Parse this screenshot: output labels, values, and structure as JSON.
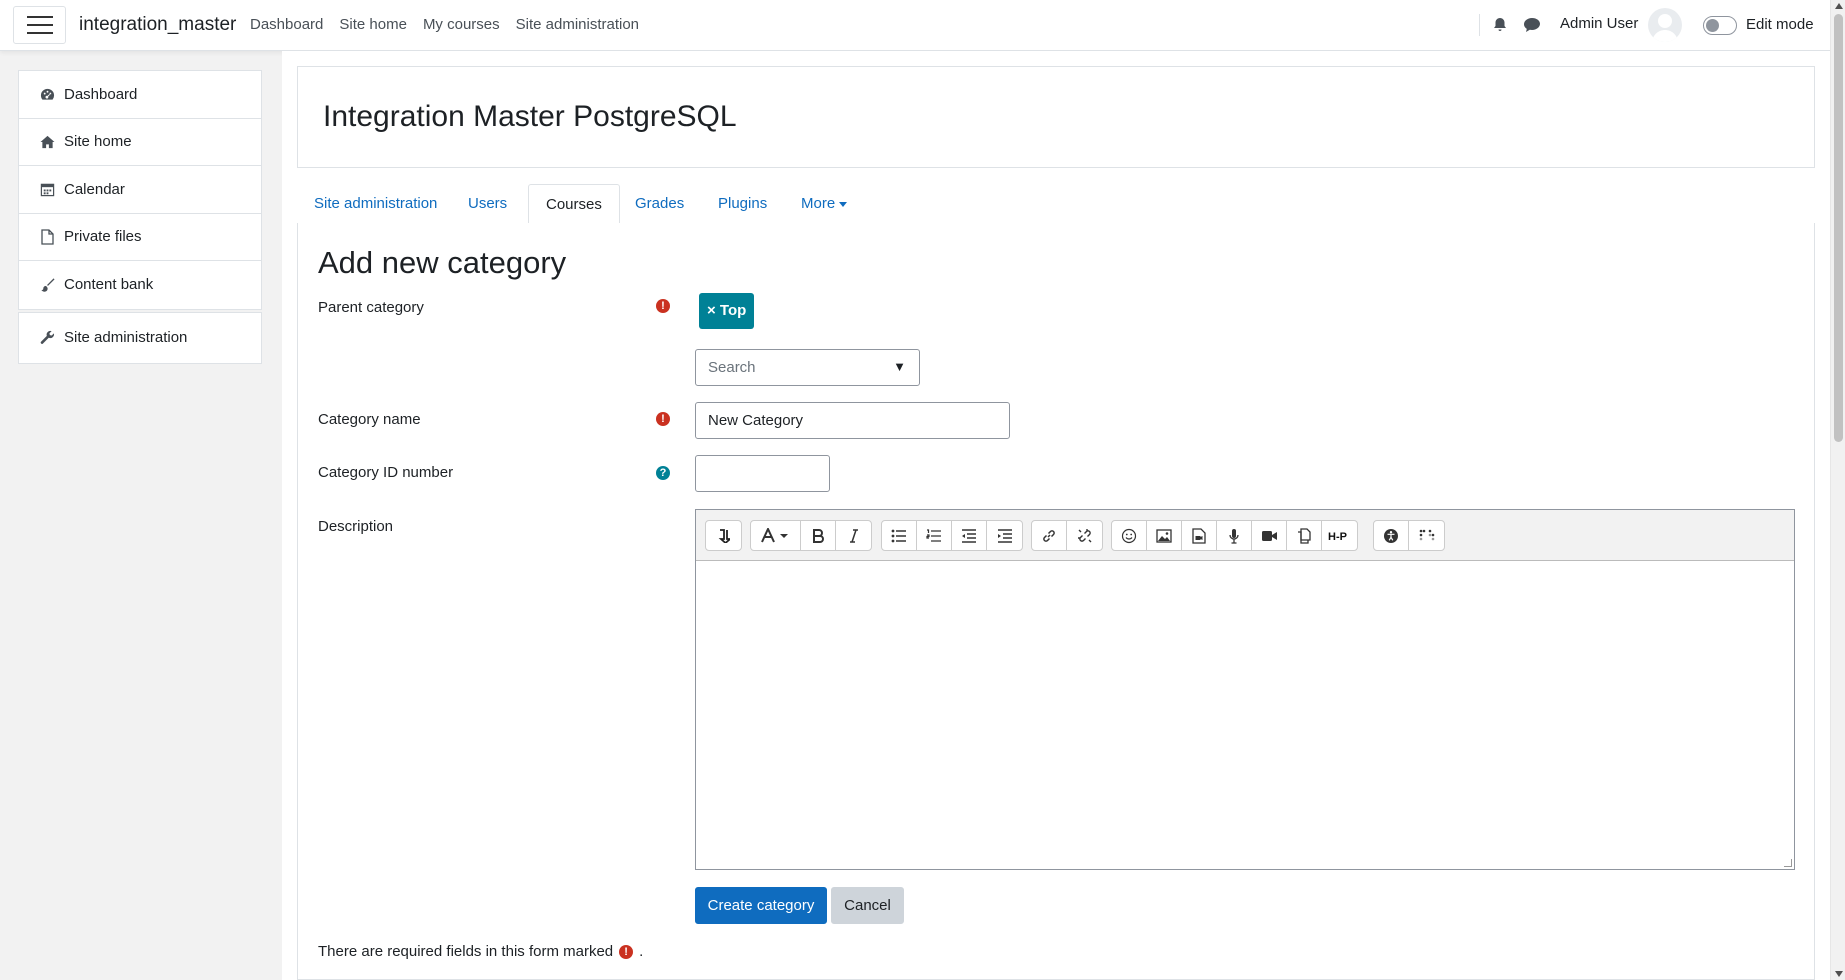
{
  "navbar": {
    "brand": "integration_master",
    "links": [
      "Dashboard",
      "Site home",
      "My courses",
      "Site administration"
    ],
    "user_name": "Admin User",
    "edit_mode_label": "Edit mode"
  },
  "sidebar": {
    "items": [
      {
        "label": "Dashboard",
        "icon": "dashboard-icon"
      },
      {
        "label": "Site home",
        "icon": "home-icon"
      },
      {
        "label": "Calendar",
        "icon": "calendar-icon"
      },
      {
        "label": "Private files",
        "icon": "file-icon"
      },
      {
        "label": "Content bank",
        "icon": "brush-icon"
      }
    ],
    "admin_item": {
      "label": "Site administration",
      "icon": "wrench-icon"
    }
  },
  "header": {
    "title": "Integration Master PostgreSQL"
  },
  "tabs": [
    {
      "label": "Site administration",
      "active": false
    },
    {
      "label": "Users",
      "active": false
    },
    {
      "label": "Courses",
      "active": true
    },
    {
      "label": "Grades",
      "active": false
    },
    {
      "label": "Plugins",
      "active": false
    },
    {
      "label": "More",
      "active": false
    }
  ],
  "form": {
    "heading": "Add new category",
    "parent_category_label": "Parent category",
    "parent_category_selected": "× Top",
    "search_placeholder": "Search",
    "search_arrow": "▼",
    "category_name_label": "Category name",
    "category_name_value": "New Category",
    "category_id_label": "Category ID number",
    "category_id_value": "",
    "description_label": "Description",
    "required_icon": "!",
    "help_icon": "?",
    "submit_label": "Create category",
    "cancel_label": "Cancel",
    "required_note": "There are required fields in this form marked",
    "required_note_end": "."
  },
  "colors": {
    "primary": "#0f6cbf",
    "required": "#ca3120",
    "teal": "#008196"
  }
}
